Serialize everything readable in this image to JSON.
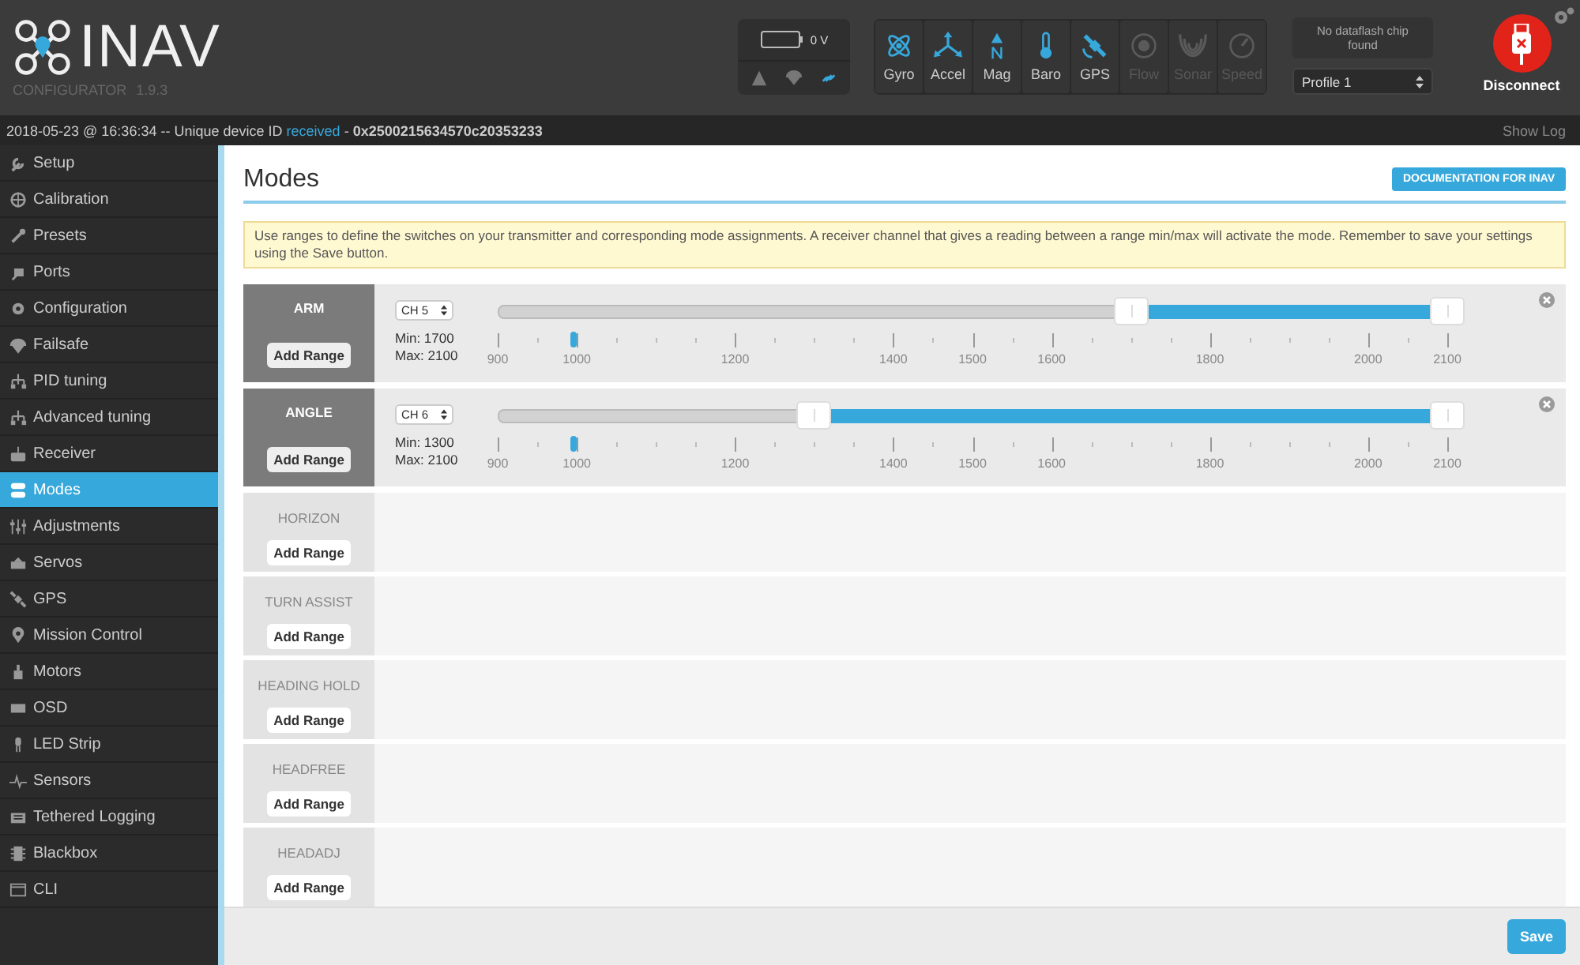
{
  "header": {
    "logo": {
      "name": "INAV",
      "subtitle": "CONFIGURATOR",
      "version": "1.9.3"
    },
    "battery": {
      "voltage": "0 V",
      "indicators": [
        {
          "active": false
        },
        {
          "active": false
        },
        {
          "active": true
        }
      ]
    },
    "sensors": [
      {
        "label": "Gyro",
        "active": true
      },
      {
        "label": "Accel",
        "active": true
      },
      {
        "label": "Mag",
        "active": true
      },
      {
        "label": "Baro",
        "active": true
      },
      {
        "label": "GPS",
        "active": true
      },
      {
        "label": "Flow",
        "active": false
      },
      {
        "label": "Sonar",
        "active": false
      },
      {
        "label": "Speed",
        "active": false
      }
    ],
    "dataflash": "No dataflash chip found",
    "profile": "Profile 1",
    "disconnect": "Disconnect"
  },
  "status_bar": {
    "message": "2018-05-23 @ 16:36:34 -- Unique device ID",
    "status": "received",
    "detail": "- **0x2500215634570c20353233**",
    "show_log": "Show Log"
  },
  "sidebar": {
    "items": [
      {
        "label": "Setup",
        "selected": false
      },
      {
        "label": "Calibration",
        "selected": false
      },
      {
        "label": "Presets",
        "selected": false
      },
      {
        "label": "Ports",
        "selected": false
      },
      {
        "label": "Configuration",
        "selected": false
      },
      {
        "label": "Failsafe",
        "selected": false
      },
      {
        "label": "PID tuning",
        "selected": false
      },
      {
        "label": "Advanced tuning",
        "selected": false
      },
      {
        "label": "Receiver",
        "selected": false
      },
      {
        "label": "Modes",
        "selected": true
      },
      {
        "label": "Adjustments",
        "selected": false
      },
      {
        "label": "Servos",
        "selected": false
      },
      {
        "label": "GPS",
        "selected": false
      },
      {
        "label": "Mission Control",
        "selected": false
      },
      {
        "label": "Motors",
        "selected": false
      },
      {
        "label": "OSD",
        "selected": false
      },
      {
        "label": "LED Strip",
        "selected": false
      },
      {
        "label": "Sensors",
        "selected": false
      },
      {
        "label": "Tethered Logging",
        "selected": false
      },
      {
        "label": "Blackbox",
        "selected": false
      },
      {
        "label": "CLI",
        "selected": false
      }
    ]
  },
  "page": {
    "title": "Modes",
    "doc_button": "DOCUMENTATION FOR INAV",
    "note": "Use ranges to define the switches on your transmitter and corresponding mode assignments. A receiver channel that gives a reading between a range min/max will activate the mode. Remember to save your settings using the Save button.",
    "modes": [
      {
        "name": "ARM",
        "active": true,
        "add_range": "Add Range",
        "ranges": [
          {
            "channel": "CH 5",
            "min": "Min: 1700",
            "max": "Max: 2100",
            "value_marker": {
              "level": 0.08
            },
            "start": {
              "level": 0.667
            },
            "end": {
              "level": 1
            },
            "ticks": [
              "900",
              "1000",
              "1200",
              "1400",
              "1500",
              "1600",
              "1800",
              "2000",
              "2100"
            ]
          }
        ]
      },
      {
        "name": "ANGLE",
        "active": true,
        "add_range": "Add Range",
        "ranges": [
          {
            "channel": "CH 6",
            "min": "Min: 1300",
            "max": "Max: 2100",
            "value_marker": {
              "level": 0.08
            },
            "start": {
              "level": 0.333
            },
            "end": {
              "level": 1
            },
            "ticks": [
              "900",
              "1000",
              "1200",
              "1400",
              "1500",
              "1600",
              "1800",
              "2000",
              "2100"
            ]
          }
        ]
      },
      {
        "name": "HORIZON",
        "active": false,
        "add_range": "Add Range"
      },
      {
        "name": "TURN ASSIST",
        "active": false,
        "add_range": "Add Range"
      },
      {
        "name": "HEADING HOLD",
        "active": false,
        "add_range": "Add Range"
      },
      {
        "name": "HEADFREE",
        "active": false,
        "add_range": "Add Range"
      },
      {
        "name": "HEADADJ",
        "active": false,
        "add_range": "Add Range"
      }
    ],
    "save": "Save"
  }
}
